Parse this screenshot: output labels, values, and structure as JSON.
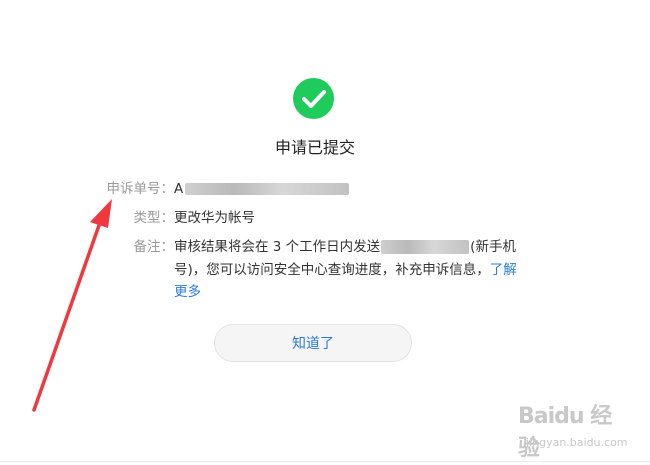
{
  "dialog": {
    "title": "申请已提交",
    "fields": {
      "appeal_number_label": "申诉单号：",
      "appeal_number_prefix": "A",
      "type_label": "类型：",
      "type_value": "更改华为帐号",
      "note_label": "备注：",
      "note_text_before": "审核结果将会在 3 个工作日内发送",
      "note_text_after": "(新手机号)，您可以访问安全中心查询进度，补充申诉信息，",
      "note_link": "了解更多"
    },
    "ok_button": "知道了"
  },
  "watermark": {
    "logo": "Baidu 经验",
    "url": "jingyan.baidu.com"
  },
  "colors": {
    "success": "#1fcc5b",
    "link": "#2a7ce0",
    "arrow": "#f0383e"
  }
}
